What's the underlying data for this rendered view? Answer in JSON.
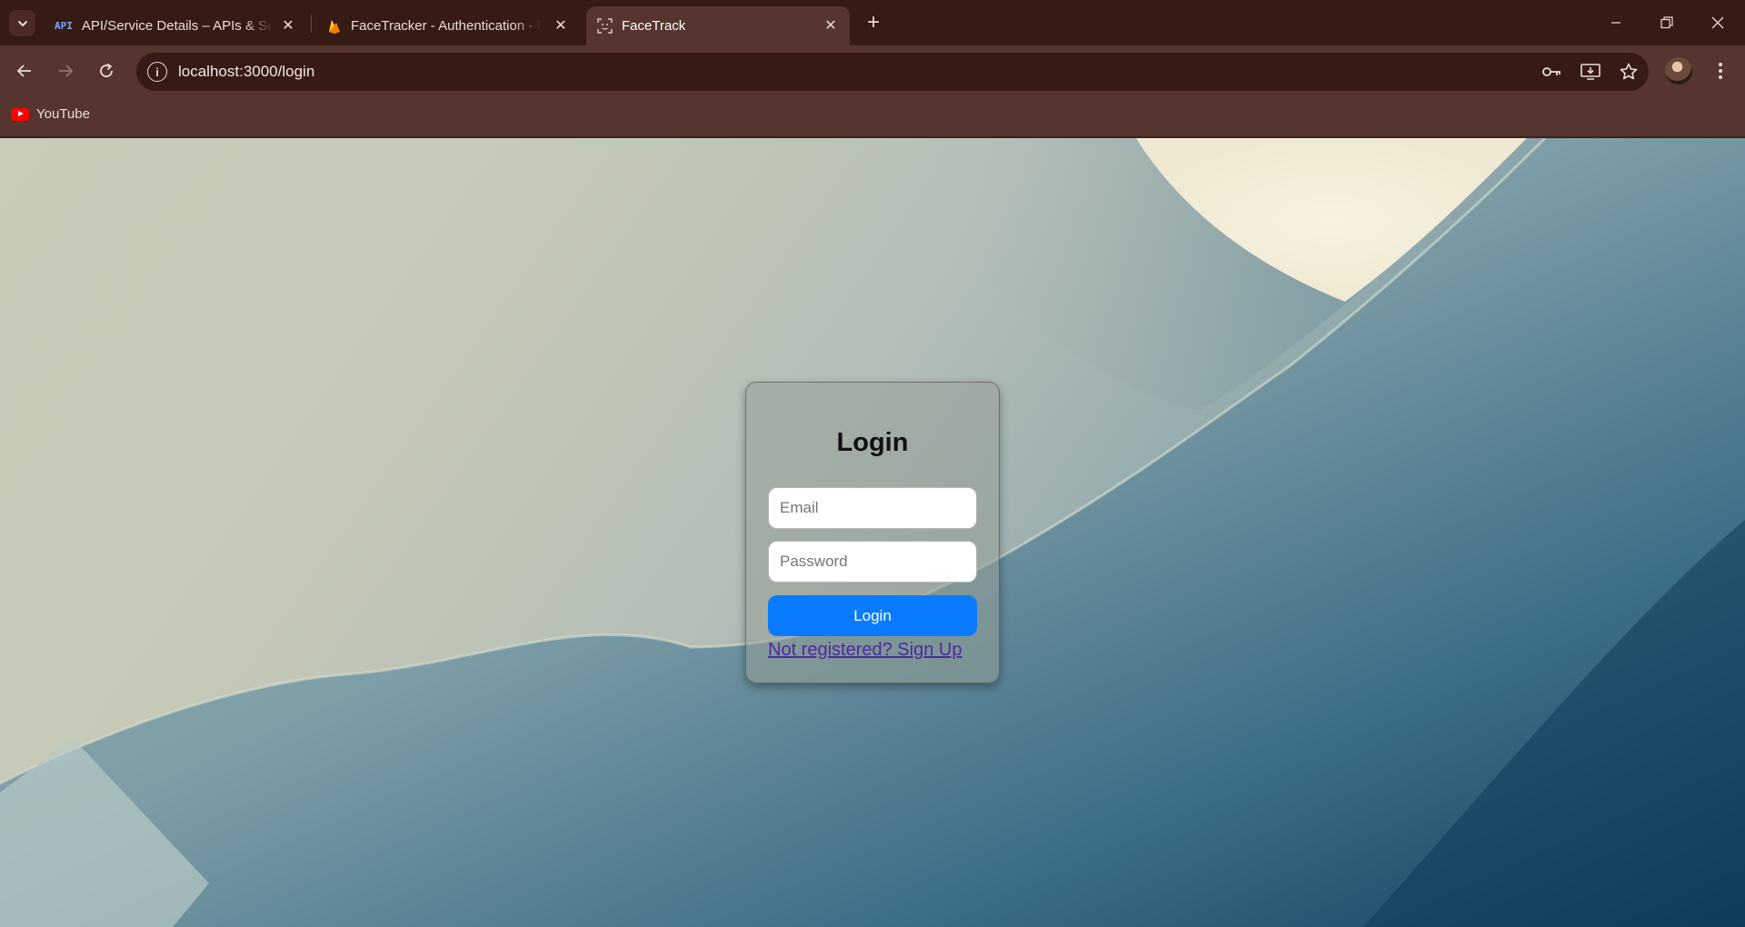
{
  "browser": {
    "tabs": [
      {
        "favicon": "API",
        "title": "API/Service Details – APIs & Services"
      },
      {
        "favicon": "firebase-icon",
        "title": "FaceTracker - Authentication - Firebase"
      },
      {
        "favicon": "face-scan-icon",
        "title": "FaceTrack",
        "active": true
      }
    ],
    "url": "localhost:3000/login",
    "bookmarks": [
      {
        "icon": "youtube-icon",
        "label": "YouTube"
      }
    ]
  },
  "login": {
    "title": "Login",
    "email_placeholder": "Email",
    "email_value": "",
    "password_placeholder": "Password",
    "password_value": "",
    "submit_label": "Login",
    "signup_link": "Not registered? Sign Up"
  },
  "colors": {
    "accent": "#0a7bff",
    "link": "#4b2aa0",
    "titlebar": "#361a14",
    "toolbar": "#55352d"
  }
}
